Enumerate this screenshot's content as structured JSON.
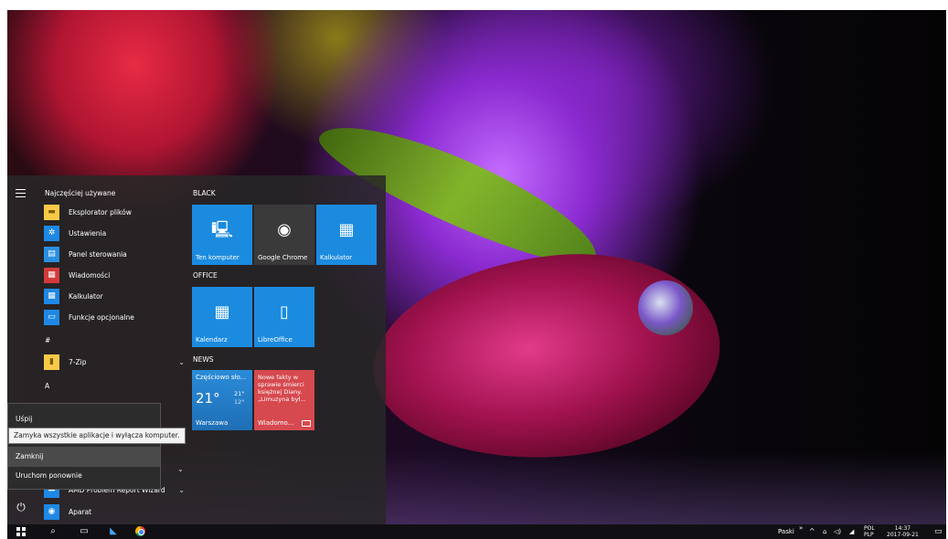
{
  "start_menu": {
    "most_used_title": "Najczęściej używane",
    "most_used": [
      {
        "label": "Eksplorator plików",
        "icon": "folder-icon"
      },
      {
        "label": "Ustawienia",
        "icon": "gear-icon"
      },
      {
        "label": "Panel sterowania",
        "icon": "control-panel-icon"
      },
      {
        "label": "Wiadomości",
        "icon": "news-icon"
      },
      {
        "label": "Kalkulator",
        "icon": "calculator-icon"
      },
      {
        "label": "Funkcje opcjonalne",
        "icon": "optional-features-icon"
      }
    ],
    "hash_header": "#",
    "seven_zip": "7-Zip",
    "a_header": "A",
    "amd_item": "AMD Problem Report Wizard",
    "aparat": "Aparat",
    "tile_groups": {
      "black": "BLACK",
      "office": "OFFICE",
      "news": "NEWS"
    },
    "tiles": {
      "ten_komputer": "Ten komputer",
      "chrome": "Google Chrome",
      "kalkulator": "Kalkulator",
      "kalendarz": "Kalendarz",
      "libreoffice": "LibreOffice",
      "weather_condition": "Częściowo sło...",
      "weather_temp": "21°",
      "weather_high": "21°",
      "weather_low": "12°",
      "weather_city": "Warszawa",
      "news_headline": "Nowe fakty w sprawie śmierci księżnej Diany. „Limuzyna był...",
      "news_label": "Wiadomo..."
    }
  },
  "power_menu": {
    "sleep": "Uśpij",
    "tooltip": "Zamyka wszystkie aplikacje i wyłącza komputer.",
    "shutdown": "Zamknij",
    "restart": "Uruchom ponownie"
  },
  "taskbar": {
    "toolbar_label": "Paski",
    "chevron": "»",
    "language": "POL",
    "language_sub": "PLP",
    "time": "14:37",
    "date": "2017-09-21"
  },
  "colors": {
    "accent": "#1b8be0",
    "news_tile": "#d6494e",
    "menu_bg": "#2c2c2c"
  }
}
